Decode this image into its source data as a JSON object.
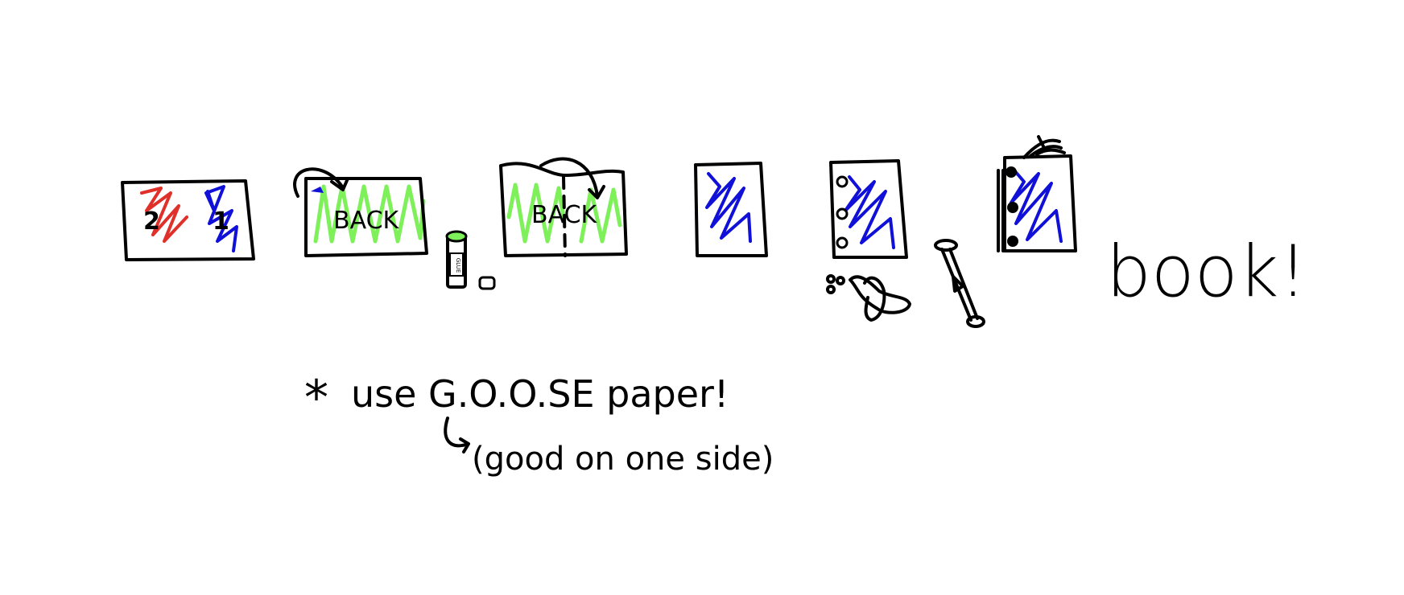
{
  "colors": {
    "ink": "#000000",
    "red": "#e0302a",
    "blue": "#1010d8",
    "green": "#7ef05a"
  },
  "steps": [
    {
      "labels": [
        "2",
        "1"
      ]
    },
    {
      "label": "BACK"
    },
    {
      "glue_stick_label": "GLUE"
    },
    {
      "label": "BACK"
    },
    {},
    {},
    {},
    {}
  ],
  "result_word": "book!",
  "note": {
    "asterisk": "*",
    "line1": "use G.O.O.SE paper!",
    "line2": "(good on one side)"
  },
  "icons": [
    "curved-arrow-icon",
    "glue-stick-icon",
    "hole-punch-icon",
    "brad-fastener-icon",
    "ribbon-icon"
  ]
}
